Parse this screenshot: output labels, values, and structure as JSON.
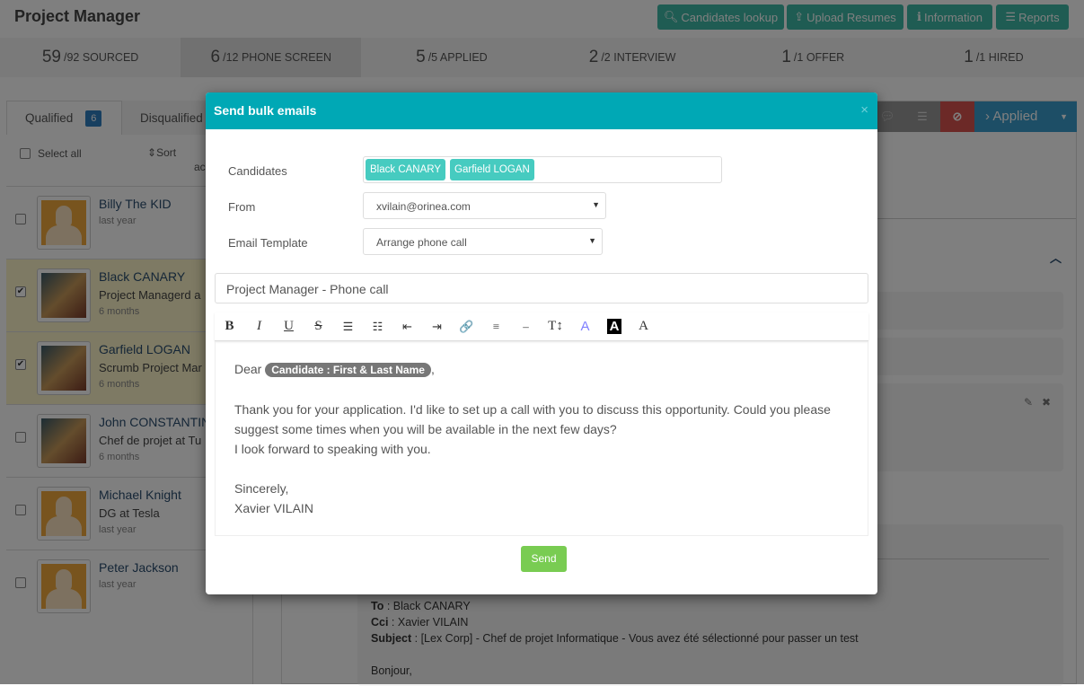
{
  "header": {
    "title": "Project Manager",
    "buttons": [
      {
        "label": "Candidates lookup",
        "icon": "search-icon"
      },
      {
        "label": "Upload Resumes",
        "icon": "upload-icon"
      },
      {
        "label": "Information",
        "icon": "info-icon"
      },
      {
        "label": "Reports",
        "icon": "list-icon"
      }
    ]
  },
  "pipeline": [
    {
      "count": "59",
      "total": "/92 SOURCED"
    },
    {
      "count": "6",
      "total": "/12 PHONE SCREEN"
    },
    {
      "count": "5",
      "total": "/5 APPLIED"
    },
    {
      "count": "2",
      "total": "/2 INTERVIEW"
    },
    {
      "count": "1",
      "total": "/1 OFFER"
    },
    {
      "count": "1",
      "total": "/1 HIRED"
    }
  ],
  "left": {
    "tabs": {
      "qualified": "Qualified",
      "qualified_count": "6",
      "disqualified": "Disqualified"
    },
    "select_all": "Select all",
    "sort": "Sort",
    "sort_extra": "ac",
    "candidates": [
      {
        "name": "Billy The KID",
        "title": "",
        "time": "last year",
        "checked": false
      },
      {
        "name": "Black CANARY",
        "title": "Project Managerd a",
        "time": "6 months",
        "checked": true
      },
      {
        "name": "Garfield LOGAN",
        "title": "Scrumb Project Mar",
        "time": "6 months",
        "checked": true
      },
      {
        "name": "John CONSTANTIN",
        "title": "Chef de projet at Tu",
        "time": "6 months",
        "checked": false
      },
      {
        "name": "Michael Knight",
        "title": "DG at Tesla",
        "time": "last year",
        "checked": false
      },
      {
        "name": "Peter Jackson",
        "title": "",
        "time": "last year",
        "checked": false
      }
    ]
  },
  "right": {
    "stage_button": "Applied",
    "colors": {
      "ban": "#d9534f",
      "stage": "#3a9ccc"
    },
    "email": {
      "to_label": "To",
      "to": "Black CANARY",
      "cci_label": "Cci",
      "cci": "Xavier VILAIN",
      "subject_label": "Subject",
      "subject": "[Lex Corp] - Chef de projet Informatique - Vous avez été sélectionné pour passer un test",
      "greeting": "Bonjour,"
    }
  },
  "modal": {
    "title": "Send bulk emails",
    "close": "×",
    "candidates_label": "Candidates",
    "candidates": [
      "Black CANARY",
      "Garfield LOGAN"
    ],
    "from_label": "From",
    "from": "xvilain@orinea.com",
    "template_label": "Email Template",
    "template": "Arrange phone call",
    "subject": "Project Manager - Phone call",
    "toolbar": [
      {
        "glyph": "B",
        "name": "bold-icon"
      },
      {
        "glyph": "I",
        "name": "italic-icon"
      },
      {
        "glyph": "U",
        "name": "underline-icon"
      },
      {
        "glyph": "S",
        "name": "strikethrough-icon"
      },
      {
        "glyph": "☰",
        "name": "bullet-list-icon"
      },
      {
        "glyph": "☷",
        "name": "numbered-list-icon"
      },
      {
        "glyph": "⇤",
        "name": "outdent-icon"
      },
      {
        "glyph": "⇥",
        "name": "indent-icon"
      },
      {
        "glyph": "🔗",
        "name": "link-icon"
      },
      {
        "glyph": "≡",
        "name": "align-icon"
      },
      {
        "glyph": "–",
        "name": "horizontal-rule-icon"
      },
      {
        "glyph": "T↕",
        "name": "font-size-icon"
      },
      {
        "glyph": "A",
        "name": "font-color-icon"
      },
      {
        "glyph": "A",
        "name": "background-color-icon"
      },
      {
        "glyph": "A",
        "name": "font-family-icon"
      }
    ],
    "body": {
      "dear": "Dear",
      "placeholder": "Candidate : First & Last Name",
      "comma": ",",
      "p1": "Thank you for your application. I'd like to set up a call with you to discuss this opportunity. Could you please suggest some times when you will be available in the next few days?",
      "p2": "I look forward to speaking with you.",
      "closing": "Sincerely,",
      "signature": "Xavier VILAIN"
    },
    "send": "Send",
    "colors": {
      "header": "#00a8b5",
      "tag": "#46cbc0",
      "send": "#79cc52"
    }
  }
}
